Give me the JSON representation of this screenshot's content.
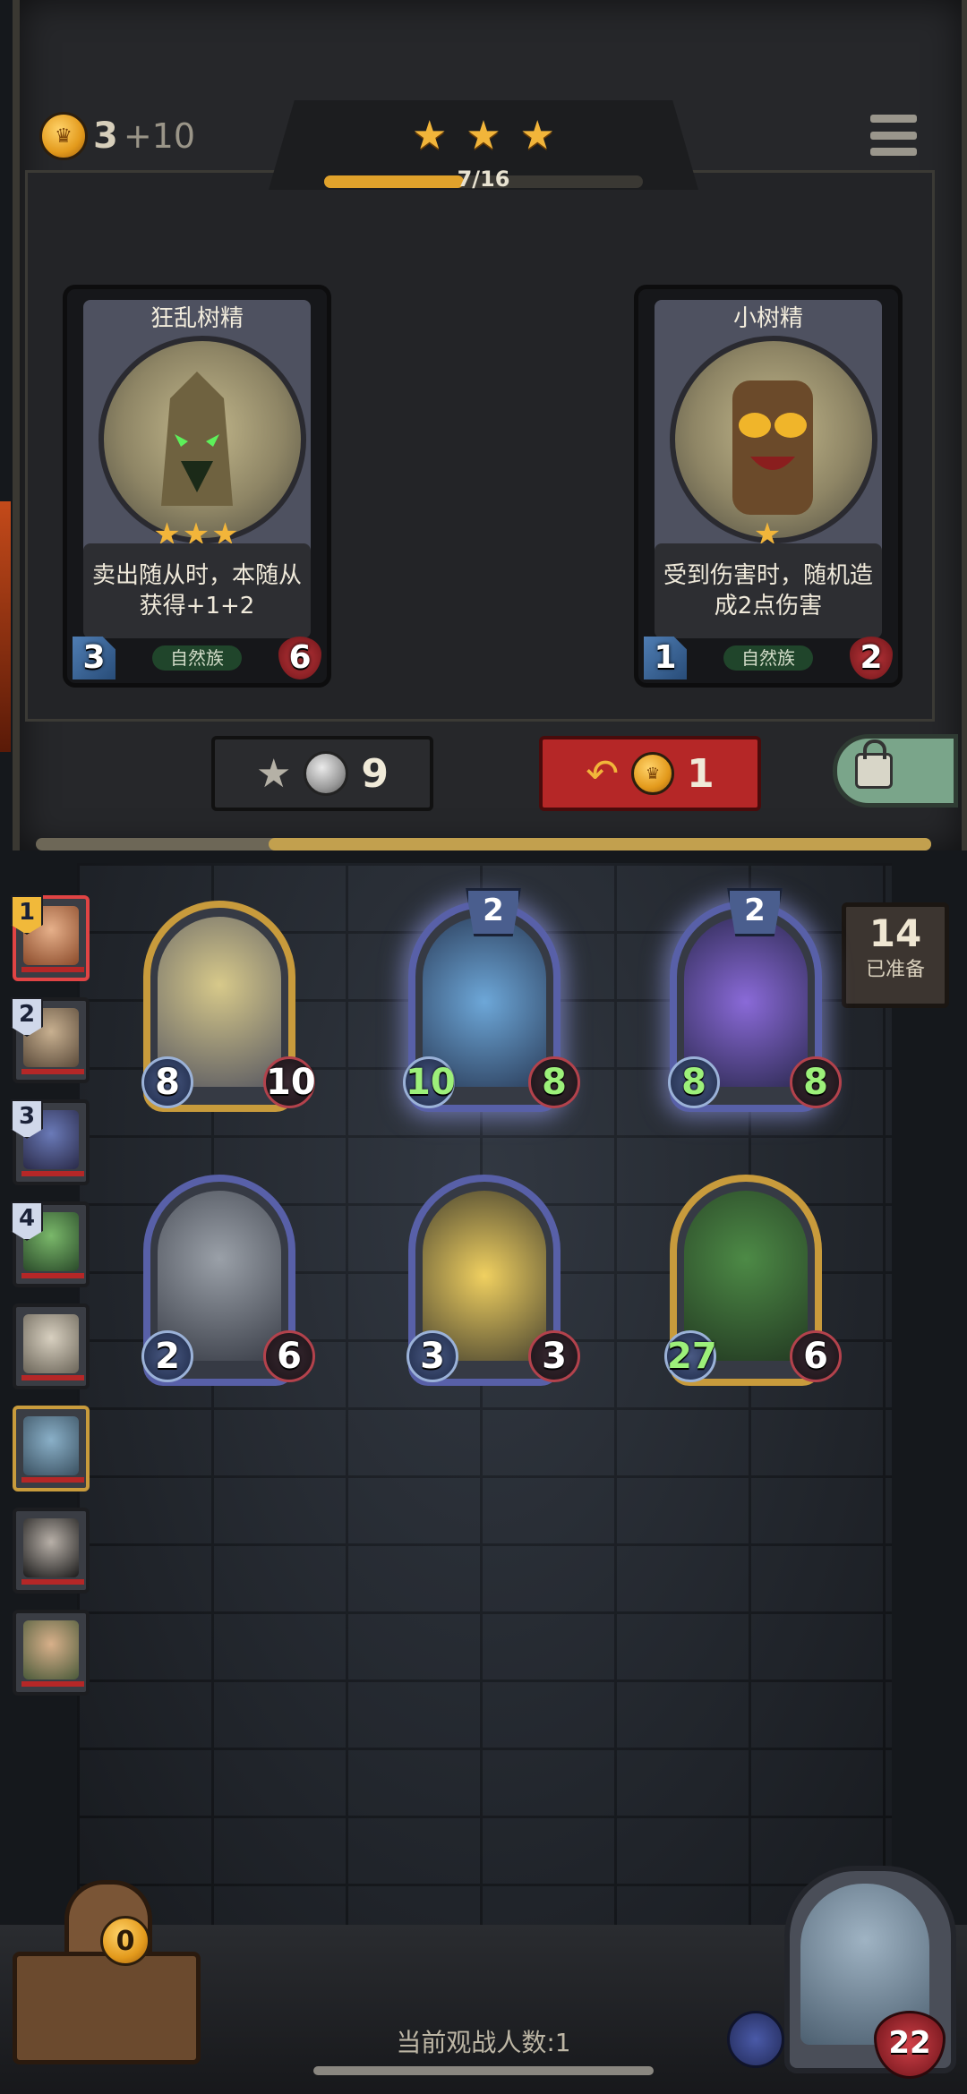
{
  "hud": {
    "gold": "3",
    "gold_income": "+10",
    "tier_stars": 3,
    "xp_text": "7/16",
    "xp_fraction": 0.4375
  },
  "shop": {
    "cards": [
      {
        "name": "狂乱树精",
        "stars": "★★★",
        "description": "卖出随从时，本随从获得+1+2",
        "tribe": "自然族",
        "attack": "3",
        "health": "6"
      },
      {
        "name": "小树精",
        "stars": "★",
        "description": "受到伤害时，随机造成2点伤害",
        "tribe": "自然族",
        "attack": "1",
        "health": "2"
      }
    ],
    "upgrade_cost": "9",
    "refresh_cost": "1"
  },
  "ready": {
    "count": "14",
    "label": "已准备"
  },
  "board": {
    "minions": [
      {
        "id": "paladin",
        "attack": "8",
        "health": "10",
        "tier": ""
      },
      {
        "id": "crab",
        "attack": "10",
        "health": "8",
        "tier": "2"
      },
      {
        "id": "mage",
        "attack": "8",
        "health": "8",
        "tier": "2"
      },
      {
        "id": "knight",
        "attack": "2",
        "health": "6",
        "tier": ""
      },
      {
        "id": "star",
        "attack": "3",
        "health": "3",
        "tier": ""
      },
      {
        "id": "treant",
        "attack": "27",
        "health": "6",
        "tier": ""
      }
    ]
  },
  "players": [
    {
      "rank": "1"
    },
    {
      "rank": "2"
    },
    {
      "rank": "3"
    },
    {
      "rank": "4"
    },
    {
      "rank": ""
    },
    {
      "rank": ""
    },
    {
      "rank": ""
    },
    {
      "rank": ""
    }
  ],
  "bottom": {
    "cart_count": "0",
    "spectators": "当前观战人数:1",
    "hero_health": "22"
  },
  "colors": {
    "gold": "#e0a22b",
    "refresh": "#b52727",
    "freeze": "#7aa58a"
  }
}
